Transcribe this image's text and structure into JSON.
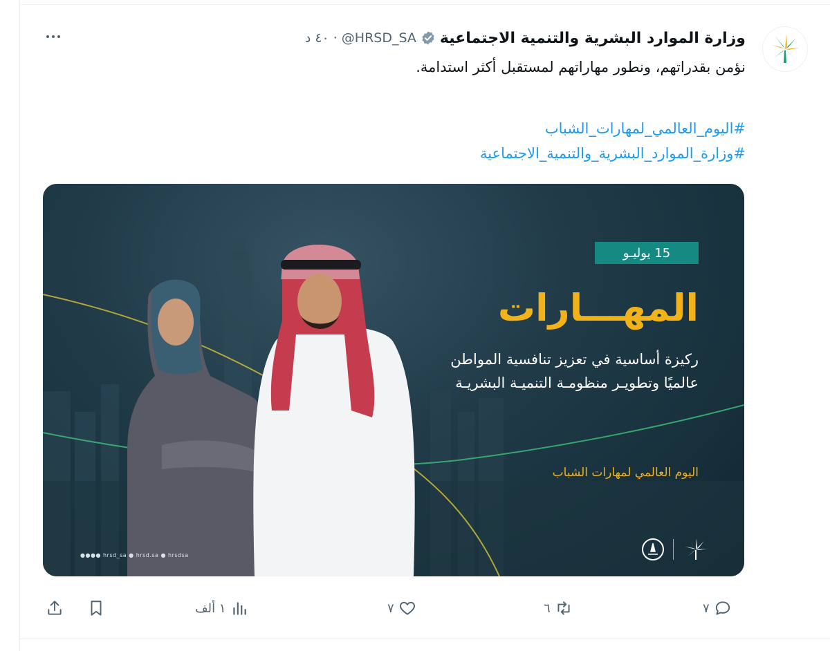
{
  "tweet": {
    "author_name": "وزارة الموارد البشرية والتنمية الاجتماعية",
    "handle": "@HRSD_SA",
    "separator": "·",
    "time": "٤٠ د",
    "text": "نؤمن بقدراتهم، ونطور مهاراتهم لمستقبل أكثر استدامة.",
    "hashtags": [
      "#اليوم_العالمي_لمهارات_الشباب",
      "#وزارة_الموارد_البشرية_والتنمية_الاجتماعية"
    ]
  },
  "media": {
    "date": "15 يوليـو",
    "title": "المهـــارات",
    "subtitle_line1": "ركيزة أساسية في تعزيز تنافسية المواطن",
    "subtitle_line2": "عالميًا وتطويـر منظومـة التنميـة البشريـة",
    "occasion": "اليوم العالمي لمهارات الشباب",
    "social_line": "●●●● hrsd_sa  ● hrsd.sa  ● hrsdsa"
  },
  "actions": {
    "replies": "٧",
    "retweets": "٦",
    "likes": "٧",
    "views": "١ ألف"
  },
  "colors": {
    "accent_link": "#1d9bf0",
    "secondary_text": "#536471",
    "primary_text": "#0f1419",
    "media_gold": "#f2b21a",
    "media_teal": "#148a83"
  }
}
